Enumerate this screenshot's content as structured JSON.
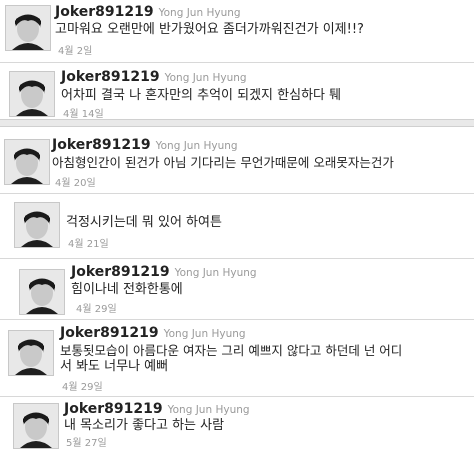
{
  "tweets": [
    {
      "handle": "Joker891219",
      "name": "Yong Jun Hyung",
      "text": "고마워요 오랜만에 반가웠어요 좀더가까워진건가 이제!!?",
      "date": "4월 2일"
    },
    {
      "handle": "Joker891219",
      "name": "Yong Jun Hyung",
      "text": "어차피 결국 나 혼자만의 추억이 되겠지 한심하다 퉤",
      "date": "4월 14일"
    },
    {
      "handle": "Joker891219",
      "name": "Yong Jun Hyung",
      "text": "아침형인간이 된건가 아님 기다리는 무언가때문에 오래못자는건가",
      "date": "4월 20일"
    },
    {
      "handle": "",
      "name": "",
      "text": "걱정시키는데 뭐 있어 하여튼",
      "date": "4월 21일"
    },
    {
      "handle": "Joker891219",
      "name": "Yong Jun Hyung",
      "text": "힘이나네 전화한통에",
      "date": "4월 29일"
    },
    {
      "handle": "Joker891219",
      "name": "Yong Jun Hyung",
      "text": "보통됫모습이 아름다운 여자는 그리 예쁘지 않다고 하던데 넌 어디",
      "text2": "서 봐도 너무나 예뻐",
      "date": "4월 29일"
    },
    {
      "handle": "Joker891219",
      "name": "Yong Jun Hyung",
      "text": "내 목소리가 좋다고 하는 사람",
      "date": "5월 27일"
    }
  ]
}
